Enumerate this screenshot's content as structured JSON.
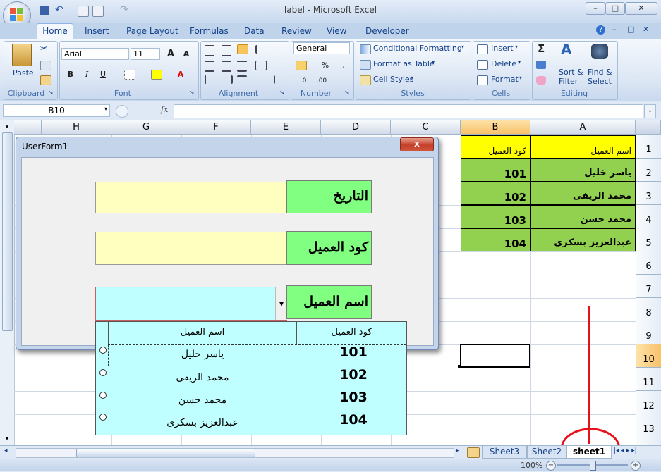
{
  "window": {
    "title": "label - Microsoft Excel"
  },
  "ribbon_tabs": [
    "Home",
    "Insert",
    "Page Layout",
    "Formulas",
    "Data",
    "Review",
    "View",
    "Developer"
  ],
  "ribbon": {
    "clipboard": {
      "paste": "Paste",
      "label": "Clipboard"
    },
    "font": {
      "name": "Arial",
      "size": "11",
      "label": "Font"
    },
    "alignment": {
      "label": "Alignment"
    },
    "number": {
      "format": "General",
      "label": "Number"
    },
    "styles": {
      "conditional": "Conditional Formatting",
      "format_table": "Format as Table",
      "cell_styles": "Cell Styles",
      "label": "Styles"
    },
    "cells": {
      "insert": "Insert",
      "delete": "Delete",
      "format": "Format",
      "label": "Cells"
    },
    "editing": {
      "sort": "Sort &",
      "filter": "Filter",
      "find": "Find &",
      "select": "Select",
      "label": "Editing"
    }
  },
  "formula_bar": {
    "name_box": "B10",
    "fx": "fx"
  },
  "columns": [
    "H",
    "G",
    "F",
    "E",
    "D",
    "C",
    "B",
    "A"
  ],
  "rows": [
    "1",
    "2",
    "3",
    "4",
    "5",
    "6",
    "7",
    "8",
    "9",
    "10",
    "11",
    "12",
    "13"
  ],
  "cells": {
    "header_a": "اسم العميل",
    "header_b": "كود العميل",
    "r2a": "ياسر خليل",
    "r2b": "101",
    "r3a": "محمد الريفى",
    "r3b": "102",
    "r4a": "محمد حسن",
    "r4b": "103",
    "r5a": "عبدالعزيز بسكرى",
    "r5b": "104"
  },
  "userform": {
    "title": "UserForm1",
    "close": "x",
    "label_date": "التاريخ",
    "label_code": "كود العميل",
    "label_name": "اسم العميل",
    "combo_arrow": "▾"
  },
  "listbox": {
    "headers": {
      "name": "اسم العميل",
      "code": "كود العميل"
    },
    "rows": [
      {
        "name": "ياسر خليل",
        "code": "101"
      },
      {
        "name": "محمد الريفى",
        "code": "102"
      },
      {
        "name": "محمد حسن",
        "code": "103"
      },
      {
        "name": "عبدالعزيز بسكرى",
        "code": "104"
      }
    ]
  },
  "sheet_tabs": {
    "t1": "Sheet3",
    "t2": "Sheet2",
    "t3": "sheet1"
  },
  "status": {
    "zoom": "100%"
  },
  "colors": {
    "header_yellow": "#ffff00",
    "data_green": "#92d050",
    "form_green": "#80ff80",
    "annotation_red": "#e8101a"
  }
}
